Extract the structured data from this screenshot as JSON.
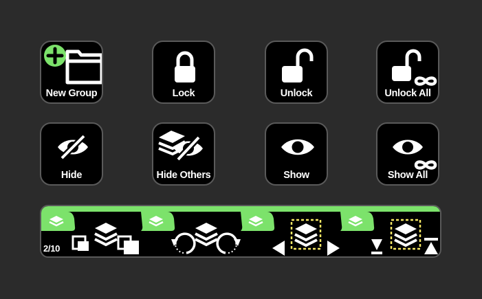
{
  "colors": {
    "accent": "#7CE26B",
    "key_bg": "#000000",
    "key_border": "#5a5a5a",
    "page_bg": "#2b2b2b"
  },
  "keys": [
    {
      "label": "New Group",
      "icon": "new-group-icon"
    },
    {
      "label": "Lock",
      "icon": "lock-icon"
    },
    {
      "label": "Unlock",
      "icon": "unlock-icon"
    },
    {
      "label": "Unlock All",
      "icon": "unlock-all-icon"
    },
    {
      "label": "Hide",
      "icon": "eye-slash-icon"
    },
    {
      "label": "Hide Others",
      "icon": "hide-others-icon"
    },
    {
      "label": "Show",
      "icon": "eye-icon"
    },
    {
      "label": "Show All",
      "icon": "show-all-icon"
    }
  ],
  "strip": {
    "counter": "2/10",
    "segments": [
      {
        "name": "layer-select",
        "icon": "layers-select-icon"
      },
      {
        "name": "layer-rotate",
        "icon": "layers-rotate-icon"
      },
      {
        "name": "layer-navigate",
        "icon": "layers-navigate-icon"
      },
      {
        "name": "layer-order",
        "icon": "layers-order-icon"
      }
    ]
  }
}
